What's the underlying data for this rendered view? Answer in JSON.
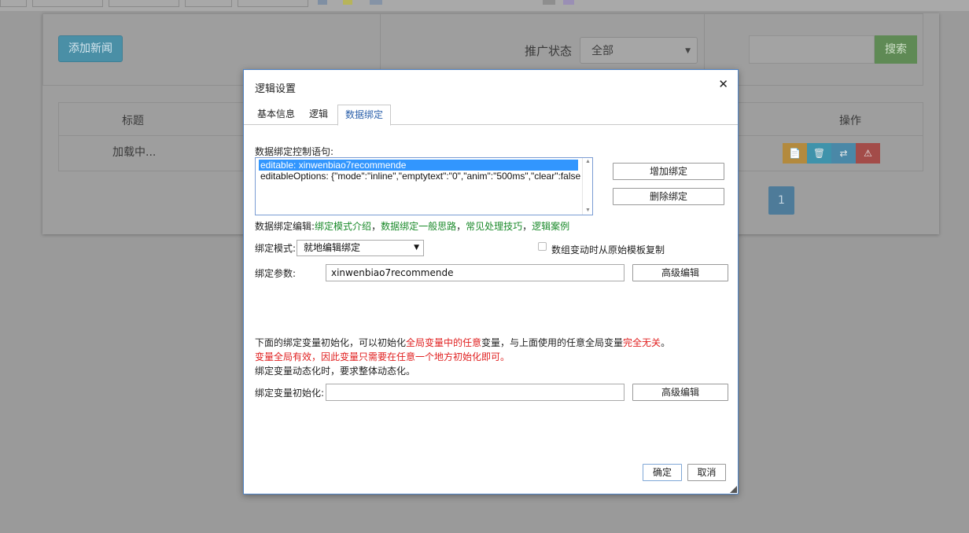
{
  "page": {
    "add_button": "添加新闻",
    "promo_label": "推广状态",
    "promo_selected": "全部",
    "search_button": "搜索",
    "table": {
      "col_title": "标题",
      "col_ops": "操作",
      "loading": "加载中..."
    },
    "pager_current": "1"
  },
  "dialog": {
    "title": "逻辑设置",
    "tabs": [
      {
        "label": "基本信息"
      },
      {
        "label": "逻辑"
      },
      {
        "label": "数据绑定"
      }
    ],
    "statement_label": "数据绑定控制语句:",
    "statement_lines": [
      "editable: xinwenbiao7recommende",
      "editableOptions: {\"mode\":\"inline\",\"emptytext\":\"0\",\"anim\":\"500ms\",\"clear\":false"
    ],
    "add_binding": "增加绑定",
    "delete_binding": "删除绑定",
    "edit_hint": {
      "prefix": "数据绑定编辑:",
      "link1": "绑定模式介绍",
      "sep1": "，",
      "link2": "数据绑定一般思路",
      "sep2": "，",
      "link3": "常见处理技巧",
      "sep3": "，",
      "link4": "逻辑案例"
    },
    "mode_label": "绑定模式:",
    "mode_value": "就地编辑绑定",
    "checkbox_label": "数组变动时从原始模板复制",
    "params_label": "绑定参数:",
    "params_value": "xinwenbiao7recommende",
    "advanced_edit": "高级编辑",
    "note1": {
      "a": "下面的绑定变量初始化，可以初始化",
      "b": "全局变量中的任意",
      "c": "变量，与上面使用的任意全局变量",
      "d": "完全无关",
      "e": "。"
    },
    "note2": "变量全局有效，因此变量只需要在任意一个地方初始化即可。",
    "note3": "绑定变量动态化时，要求整体动态化。",
    "init_label": "绑定变量初始化:",
    "init_value": "",
    "advanced_edit2": "高级编辑",
    "ok": "确定",
    "cancel": "取消"
  },
  "colors": {
    "link": "#1a8a2a",
    "warn": "#e02020",
    "accent": "#2a5faa",
    "selection": "#3296fe"
  }
}
